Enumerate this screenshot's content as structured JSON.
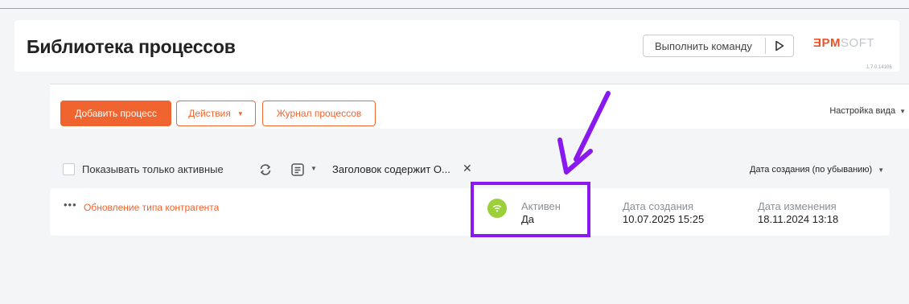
{
  "header": {
    "title": "Библиотека процессов",
    "command_label": "Выполнить команду",
    "brand_part1": "ƎPM",
    "brand_part2": "SOFT",
    "version": "1.7.0.14106"
  },
  "toolbar": {
    "add_label": "Добавить процесс",
    "actions_label": "Действия",
    "journal_label": "Журнал процессов",
    "view_settings_label": "Настройка вида"
  },
  "filters": {
    "active_only_label": "Показывать только активные",
    "active_only_checked": false,
    "filter_text": "Заголовок содержит О...",
    "sort_label": "Дата создания (по убыванию)"
  },
  "rows": [
    {
      "name": "Обновление типа контрагента",
      "active_label": "Активен",
      "active_value": "Да",
      "created_label": "Дата создания",
      "created_value": "10.07.2025 15:25",
      "modified_label": "Дата изменения",
      "modified_value": "18.11.2024 13:18"
    }
  ],
  "colors": {
    "accent": "#f0652f",
    "annotation": "#8a19f0",
    "status_active": "#9ccf3a"
  },
  "icons": {
    "command": "play-triangle-icon",
    "refresh": "refresh-icon",
    "filter": "filter-list-icon",
    "status": "wifi-signal-icon",
    "annotation": "arrow-annotation"
  }
}
